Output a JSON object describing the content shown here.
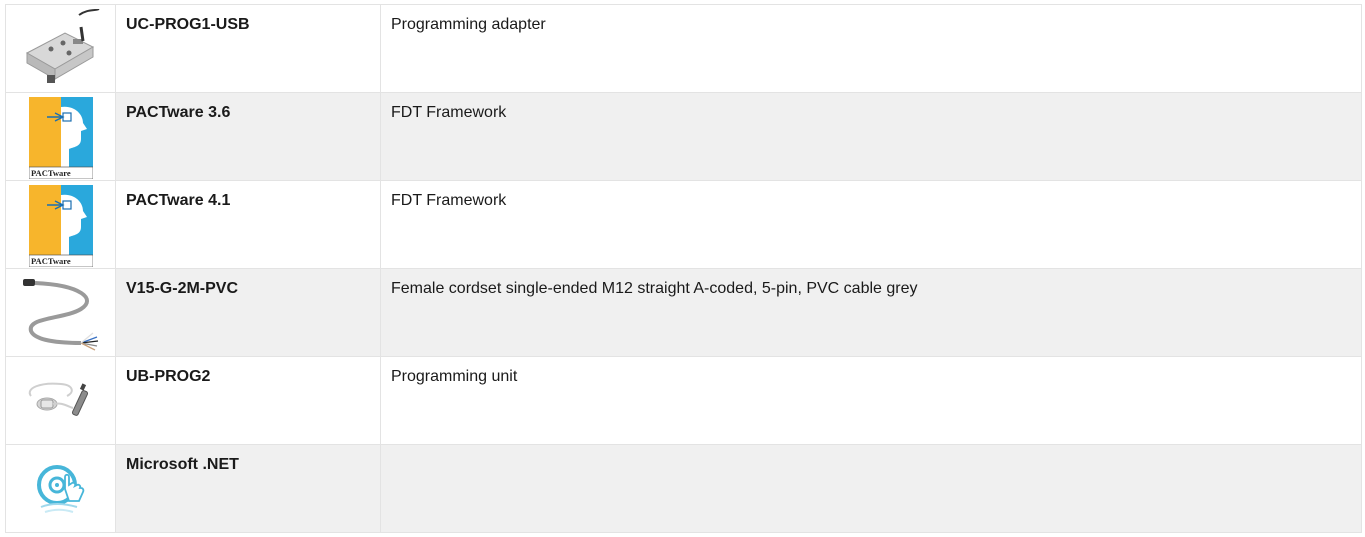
{
  "rows": [
    {
      "name": "UC-PROG1-USB",
      "description": "Programming adapter",
      "icon": "usb-programming-adapter-icon"
    },
    {
      "name": "PACTware 3.6",
      "description": "FDT Framework",
      "icon": "pactware-logo-icon",
      "logo_text": "PACTware"
    },
    {
      "name": "PACTware 4.1",
      "description": "FDT Framework",
      "icon": "pactware-logo-icon",
      "logo_text": "PACTware"
    },
    {
      "name": "V15-G-2M-PVC",
      "description": "Female cordset single-ended M12 straight A-coded, 5-pin, PVC cable grey",
      "icon": "cordset-cable-icon"
    },
    {
      "name": "UB-PROG2",
      "description": "Programming unit",
      "icon": "programming-unit-icon"
    },
    {
      "name": "Microsoft .NET",
      "description": "",
      "icon": "software-cd-icon"
    }
  ],
  "colors": {
    "pactware_yellow": "#f7b52c",
    "pactware_blue": "#2aa8dc",
    "cd_blue": "#47b6d9",
    "row_alt_bg": "#f0f0f0",
    "border": "#e3e3e3"
  }
}
